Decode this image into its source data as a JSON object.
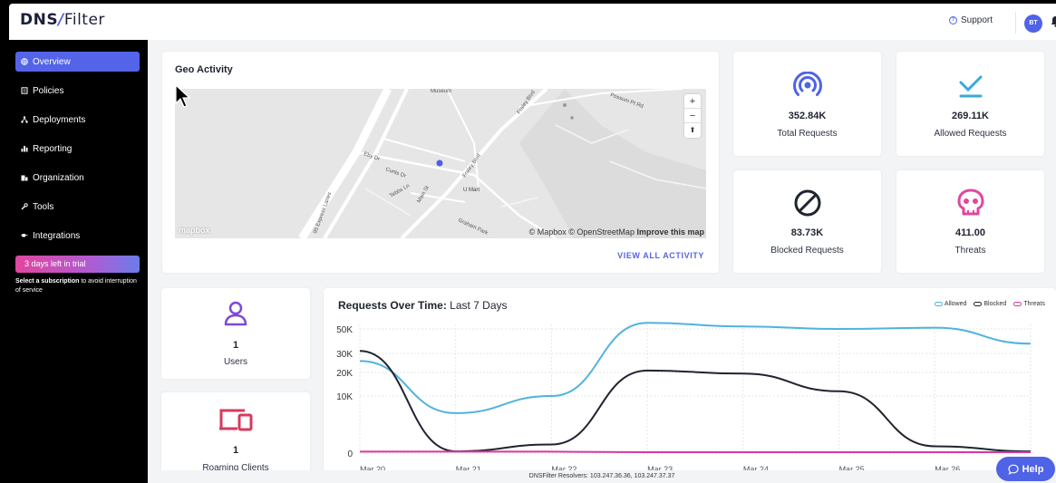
{
  "header": {
    "logo_main": "DNS",
    "logo_slash": "/",
    "logo_tail": "Filter",
    "support_label": "Support",
    "avatar_initials": "BT"
  },
  "sidebar": {
    "items": [
      {
        "label": "Overview",
        "icon": "globe-icon",
        "active": true
      },
      {
        "label": "Policies",
        "icon": "policies-icon",
        "active": false
      },
      {
        "label": "Deployments",
        "icon": "deployments-icon",
        "active": false
      },
      {
        "label": "Reporting",
        "icon": "bar-chart-icon",
        "active": false
      },
      {
        "label": "Organization",
        "icon": "organization-icon",
        "active": false
      },
      {
        "label": "Tools",
        "icon": "wrench-icon",
        "active": false
      },
      {
        "label": "Integrations",
        "icon": "plug-icon",
        "active": false
      }
    ],
    "trial_banner": "3 days left in trial",
    "trial_note_bold": "Select a subscription",
    "trial_note_rest": " to avoid interruption of service"
  },
  "geo": {
    "title": "Geo Activity",
    "map_labels": [
      "Museum",
      "Fraley Blvd",
      "Possum Pt Rd",
      "Eby Dr",
      "Curtis Dr",
      "Fraley Blvd",
      "95 Express Lanes",
      "Main St",
      "Tebbs Ln",
      "U Mart",
      "Graham Park"
    ],
    "attribution_prefix": "© Mapbox © OpenStreetMap",
    "attribution_link": "Improve this map",
    "mapbox_logo": "mapbox",
    "zoom_in": "+",
    "zoom_out": "−",
    "compass": "⬆",
    "view_all": "VIEW ALL ACTIVITY"
  },
  "stats": [
    {
      "value": "352.84K",
      "label": "Total Requests",
      "icon": "signal-icon",
      "color": "#4f63e6"
    },
    {
      "value": "269.11K",
      "label": "Allowed Requests",
      "icon": "checkmark-icon",
      "color": "#3aa9d9"
    },
    {
      "value": "83.73K",
      "label": "Blocked Requests",
      "icon": "blocked-icon",
      "color": "#1f2430"
    },
    {
      "value": "411.00",
      "label": "Threats",
      "icon": "skull-icon",
      "color": "#e0469f"
    }
  ],
  "users": {
    "value": "1",
    "label": "Users",
    "icon": "user-icon",
    "color": "#7b4ad8"
  },
  "roaming": {
    "value": "1",
    "label": "Roaming Clients",
    "icon": "devices-icon",
    "color": "#d63a5e"
  },
  "chart_panel": {
    "title_bold": "Requests Over Time:",
    "title_rest": " Last 7 Days"
  },
  "chart_data": {
    "type": "line",
    "title": "Requests Over Time: Last 7 Days",
    "xlabel": "",
    "ylabel": "",
    "y_ticks": [
      "0",
      "10K",
      "20K",
      "30K",
      "50K"
    ],
    "x": [
      "Mar 20",
      "Mar 21",
      "Mar 22",
      "Mar 23",
      "Mar 24",
      "Mar 25",
      "Mar 26"
    ],
    "series": [
      {
        "name": "Allowed",
        "color": "#4fb3dd",
        "values": [
          26000,
          7000,
          10000,
          55000,
          52000,
          50000,
          51000,
          38000
        ]
      },
      {
        "name": "Blocked",
        "color": "#1f2430",
        "values": [
          32000,
          300,
          1500,
          21000,
          19500,
          12000,
          1200,
          300
        ]
      },
      {
        "name": "Threats",
        "color": "#d63aa0",
        "values": [
          250,
          250,
          250,
          150,
          150,
          150,
          150,
          150
        ]
      }
    ],
    "legend_position": "top-right",
    "grid": true
  },
  "footer": {
    "resolvers": "DNSFilter Resolvers: 103.247.36.36, 103.247.37.37"
  },
  "help": {
    "label": "Help"
  }
}
